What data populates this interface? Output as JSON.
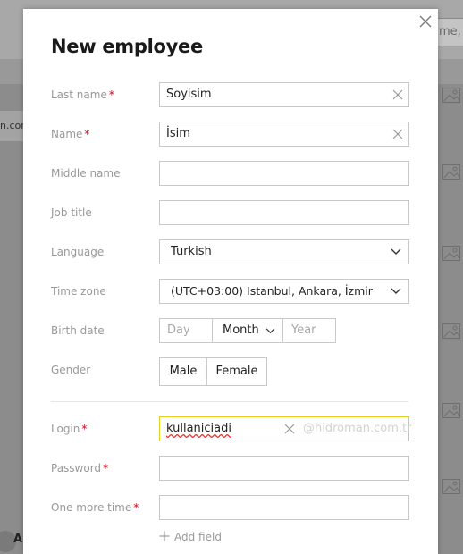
{
  "background": {
    "search_partial": "me,",
    "left_partial": "n.con",
    "bottom_letter": "A"
  },
  "modal": {
    "title": "New employee",
    "fields": {
      "last_name": {
        "label": "Last name",
        "required_mark": "*",
        "value": "Soyisim"
      },
      "name": {
        "label": "Name",
        "required_mark": "*",
        "value": "İsim"
      },
      "middle_name": {
        "label": "Middle name",
        "value": ""
      },
      "job_title": {
        "label": "Job title",
        "value": ""
      },
      "language": {
        "label": "Language",
        "value": "Turkish"
      },
      "time_zone": {
        "label": "Time zone",
        "value": "(UTC+03:00) Istanbul, Ankara, İzmir"
      },
      "birth_date": {
        "label": "Birth date",
        "day_placeholder": "Day",
        "month_value": "Month",
        "year_placeholder": "Year"
      },
      "gender": {
        "label": "Gender",
        "options": [
          "Male",
          "Female"
        ]
      },
      "login": {
        "label": "Login",
        "required_mark": "*",
        "value": "kullaniciadi",
        "domain_suffix": "@hidroman.com.tr"
      },
      "password": {
        "label": "Password",
        "required_mark": "*",
        "value": ""
      },
      "password_repeat": {
        "label": "One more time",
        "required_mark": "*",
        "value": ""
      }
    },
    "add_field_label": "Add field"
  },
  "colors": {
    "required": "#d0021b",
    "label": "#999999",
    "focus_border": "#e6d21e",
    "overlay": "#8c8c8c"
  }
}
